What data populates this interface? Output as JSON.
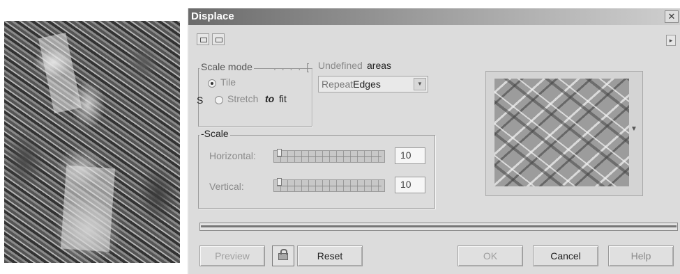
{
  "dialog": {
    "title": "Displace",
    "close_label": "✕"
  },
  "scale_mode": {
    "legend": "Scale mode",
    "dots": ". . . . [",
    "tile_label": "Tile",
    "stretch_prefix": "S",
    "stretch_label": "Stretch",
    "stretch_to": "to",
    "stretch_fit": "fit",
    "selected": "Tile"
  },
  "undefined_areas": {
    "label_prefix": "Undefined",
    "label_suffix": "areas",
    "selected_part1": "Repeat",
    "selected_part2": "Edges"
  },
  "scale": {
    "legend": "-Scale",
    "horizontal_label": "Horizontal:",
    "horizontal_value": "10",
    "vertical_label": "Vertical:",
    "vertical_value": "10"
  },
  "buttons": {
    "preview": "Preview",
    "reset": "Reset",
    "ok": "OK",
    "cancel": "Cancel",
    "help": "Help"
  },
  "icons": {
    "toolbar_left": "layout-icon",
    "toolbar_right": "layout-icon",
    "menu": "right-arrow-icon",
    "lock": "lock-icon",
    "pane_menu": "triangle-down-icon"
  }
}
